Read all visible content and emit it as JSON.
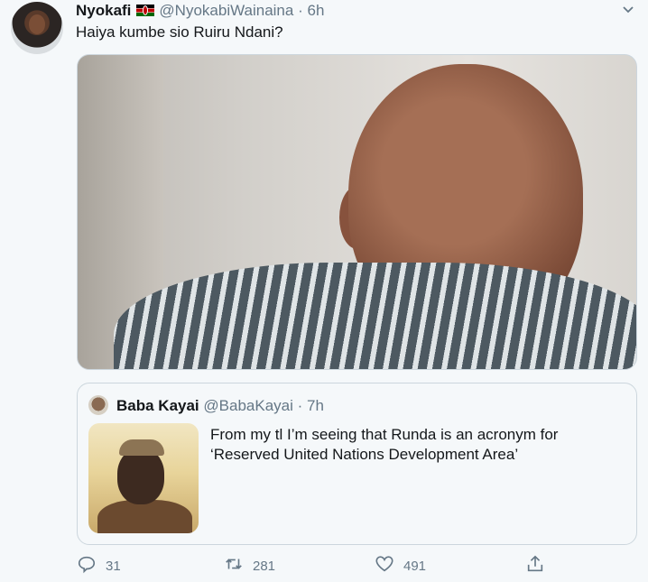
{
  "tweet": {
    "display_name": "Nyokafi",
    "handle": "@NyokabiWainaina",
    "separator": "·",
    "time": "6h",
    "text": "Haiya kumbe sio Ruiru Ndani?",
    "flag_icon": "kenya-flag-icon",
    "menu_icon": "chevron-down-icon"
  },
  "quoted": {
    "display_name": "Baba Kayai",
    "handle": "@BabaKayai",
    "separator": "·",
    "time": "7h",
    "text": "From my tl I’m seeing that Runda is an acronym for ‘Reserved United Nations Development Area’"
  },
  "actions": {
    "reply_count": "31",
    "retweet_count": "281",
    "like_count": "491"
  }
}
